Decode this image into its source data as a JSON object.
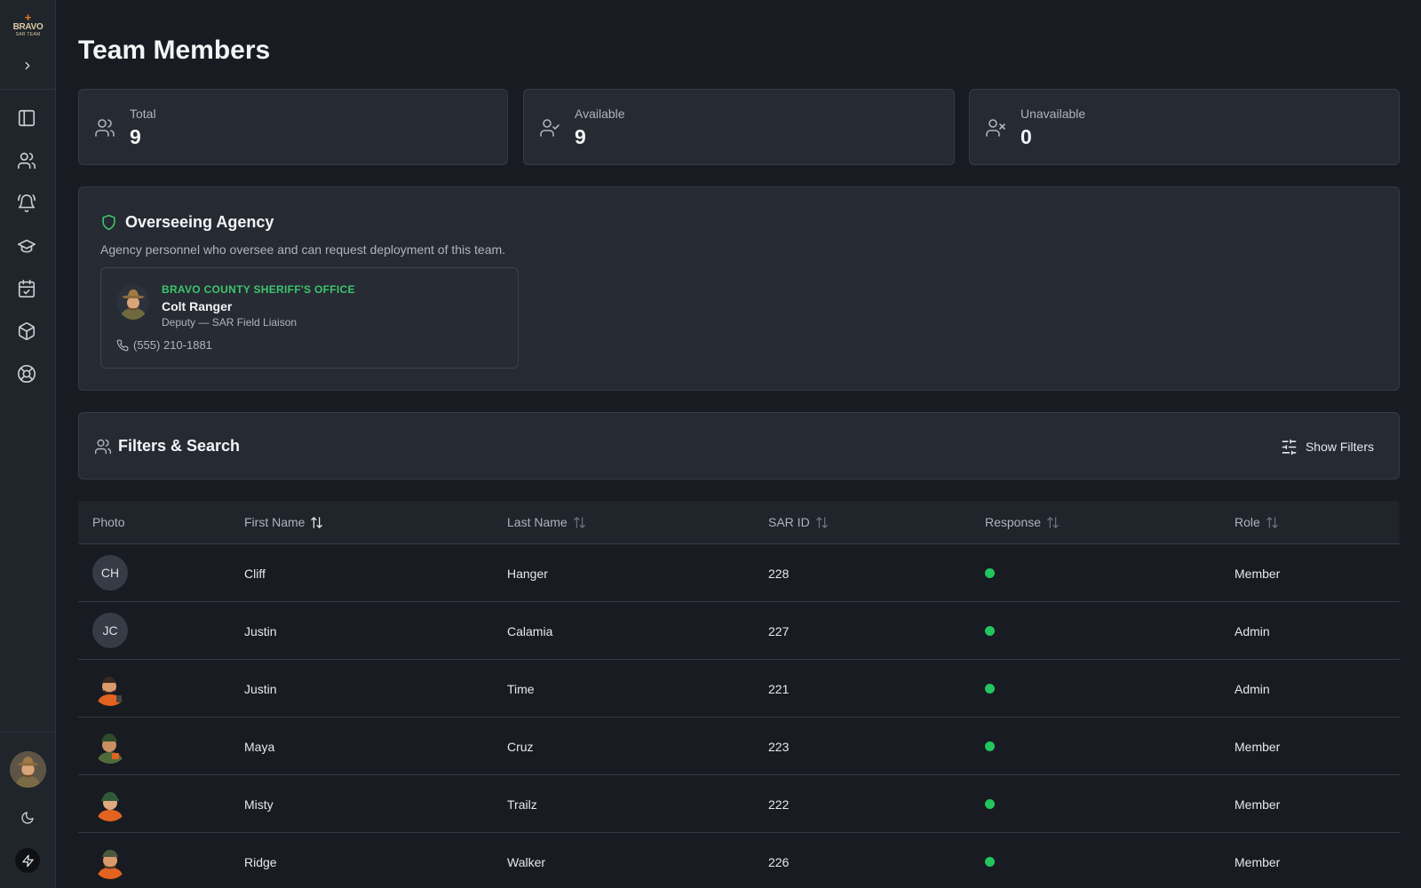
{
  "sidebar": {
    "logo": {
      "mark": "+",
      "brand": "BRAVO",
      "sub": "SAR TEAM"
    },
    "nav": [
      {
        "name": "dashboard",
        "icon": "panel-icon"
      },
      {
        "name": "members",
        "icon": "users-icon"
      },
      {
        "name": "alerts",
        "icon": "bell-ring-icon"
      },
      {
        "name": "training",
        "icon": "graduation-cap-icon"
      },
      {
        "name": "calendar",
        "icon": "calendar-check-icon"
      },
      {
        "name": "equipment",
        "icon": "package-icon"
      },
      {
        "name": "support",
        "icon": "life-buoy-icon"
      }
    ]
  },
  "page": {
    "title": "Team Members"
  },
  "stats": [
    {
      "label": "Total",
      "value": "9",
      "icon": "users-icon"
    },
    {
      "label": "Available",
      "value": "9",
      "icon": "user-check-icon"
    },
    {
      "label": "Unavailable",
      "value": "0",
      "icon": "user-x-icon"
    }
  ],
  "agency": {
    "title": "Overseeing Agency",
    "description": "Agency personnel who oversee and can request deployment of this team.",
    "contact": {
      "org": "BRAVO COUNTY SHERIFF'S OFFICE",
      "name": "Colt Ranger",
      "role": "Deputy — SAR Field Liaison",
      "phone": "(555) 210-1881"
    }
  },
  "filters": {
    "title": "Filters & Search",
    "toggle_label": "Show Filters"
  },
  "table": {
    "headers": {
      "photo": "Photo",
      "first": "First Name",
      "last": "Last Name",
      "sar": "SAR ID",
      "response": "Response",
      "role": "Role"
    },
    "rows": [
      {
        "initials": "CH",
        "first": "Cliff",
        "last": "Hanger",
        "sar": "228",
        "role": "Member"
      },
      {
        "initials": "JC",
        "first": "Justin",
        "last": "Calamia",
        "sar": "227",
        "role": "Admin"
      },
      {
        "initials": "",
        "first": "Justin",
        "last": "Time",
        "sar": "221",
        "role": "Admin"
      },
      {
        "initials": "",
        "first": "Maya",
        "last": "Cruz",
        "sar": "223",
        "role": "Member"
      },
      {
        "initials": "",
        "first": "Misty",
        "last": "Trailz",
        "sar": "222",
        "role": "Member"
      },
      {
        "initials": "",
        "first": "Ridge",
        "last": "Walker",
        "sar": "226",
        "role": "Member"
      }
    ]
  },
  "colors": {
    "available": "#22c55e",
    "agency_accent": "#3ec46d",
    "logo_accent": "#e07a2c"
  }
}
